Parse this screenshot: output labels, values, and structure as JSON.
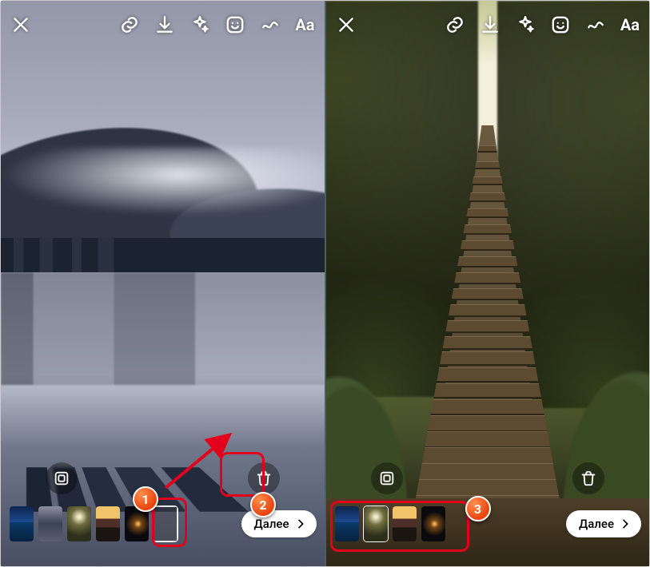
{
  "icons": {
    "close": "close-icon",
    "link": "link-icon",
    "download": "download-icon",
    "sparkle": "sparkle-icon",
    "sticker": "sticker-icon",
    "draw": "draw-icon",
    "text_tool": "Aa",
    "layout": "layout-icon",
    "trash": "trash-icon"
  },
  "next_label": "Далее",
  "annotations": {
    "b1": "1",
    "b2": "2",
    "b3": "3"
  },
  "left": {
    "thumbs": [
      {
        "name": "thumb-1",
        "cls": "t-a",
        "interact": true
      },
      {
        "name": "thumb-2",
        "cls": "t-b",
        "interact": true
      },
      {
        "name": "thumb-3",
        "cls": "t-c",
        "interact": true
      },
      {
        "name": "thumb-4",
        "cls": "t-d",
        "interact": true
      },
      {
        "name": "thumb-5",
        "cls": "t-e",
        "interact": true
      },
      {
        "name": "thumb-6",
        "cls": "t-empty",
        "interact": true,
        "selected": true
      }
    ]
  },
  "right": {
    "thumbs": [
      {
        "name": "thumb-1",
        "cls": "t-a",
        "interact": true
      },
      {
        "name": "thumb-2",
        "cls": "t-c",
        "interact": true,
        "selected": true
      },
      {
        "name": "thumb-3",
        "cls": "t-d",
        "interact": true
      },
      {
        "name": "thumb-4",
        "cls": "t-e",
        "interact": true
      }
    ]
  }
}
